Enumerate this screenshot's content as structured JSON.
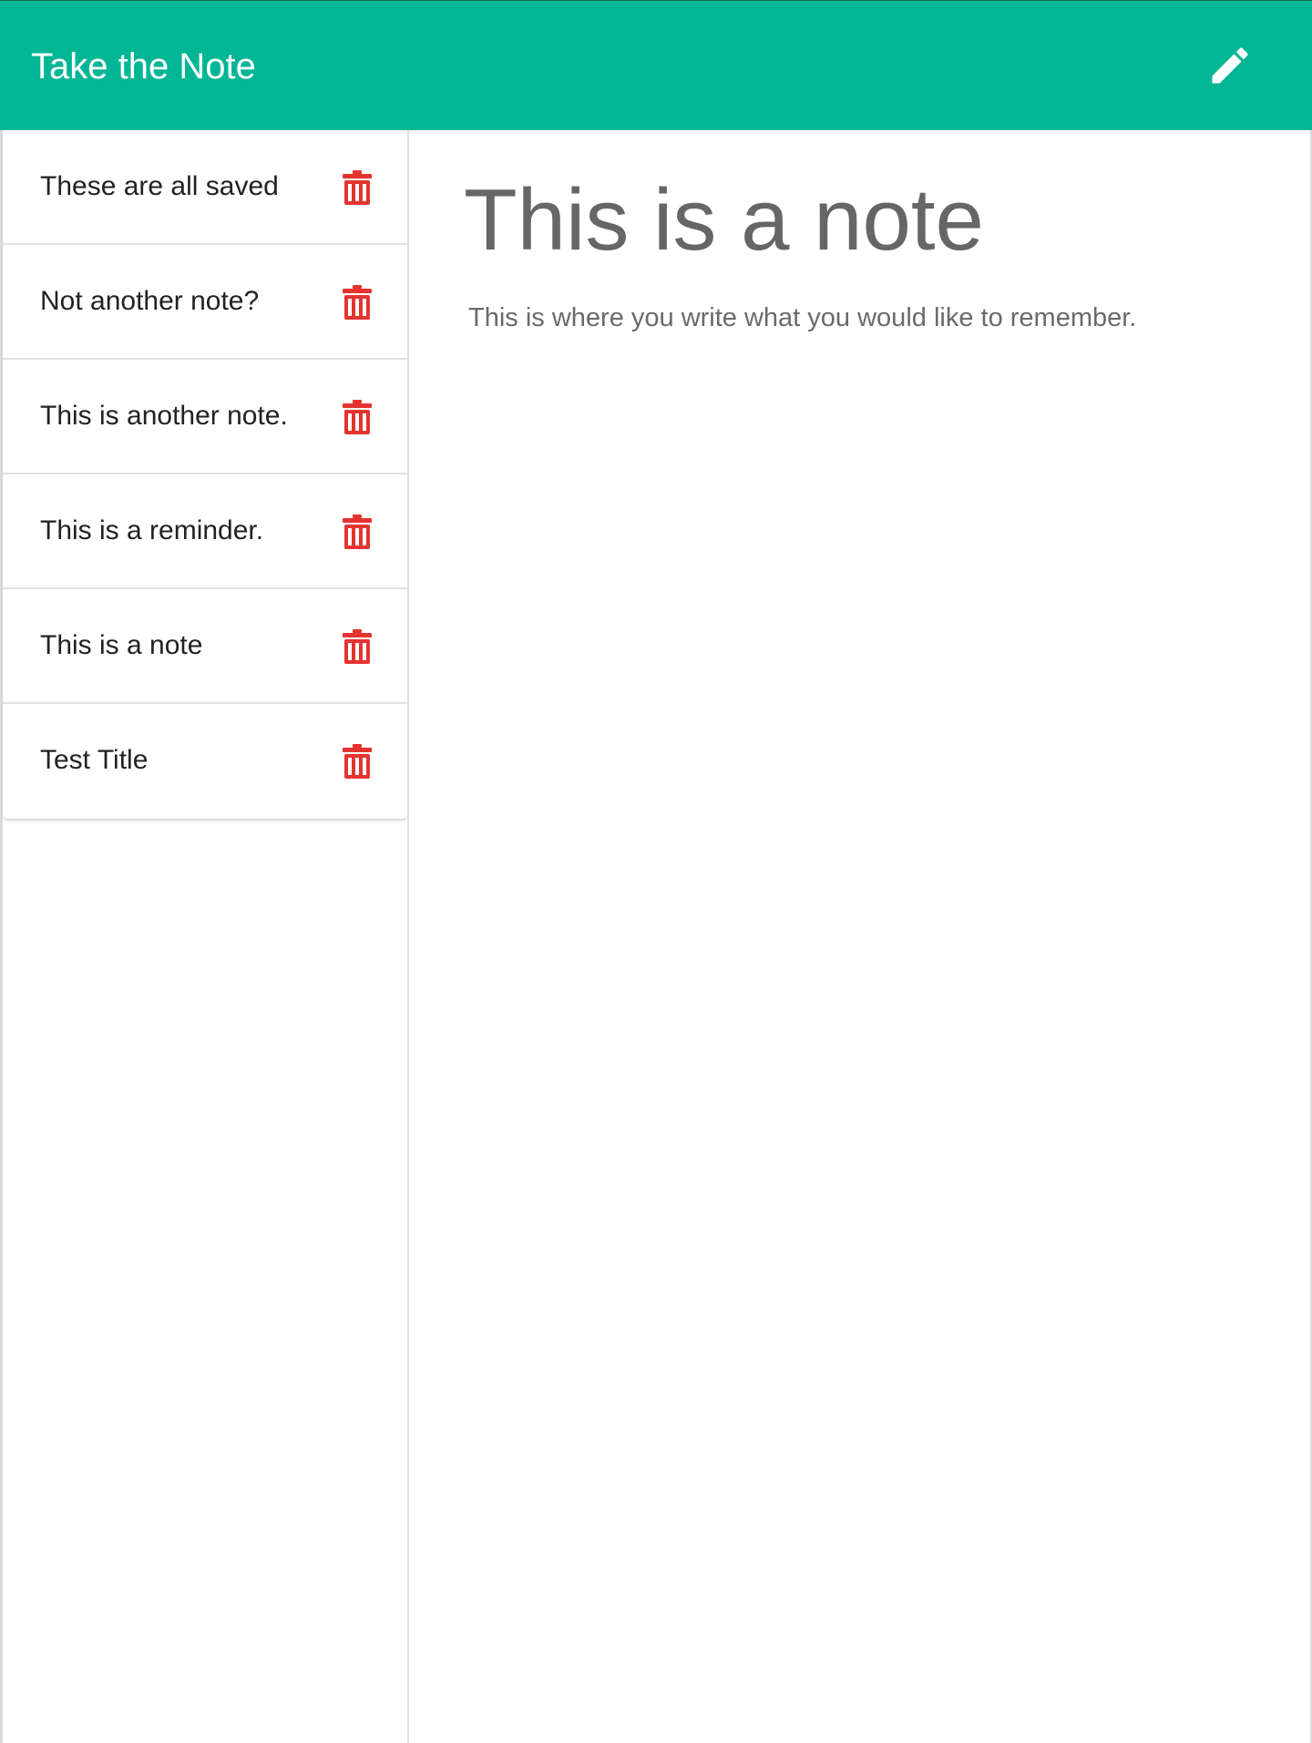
{
  "navbar": {
    "app_title": "Take the Note",
    "new_note_icon": "pencil-icon",
    "accent_color": "#00b695"
  },
  "sidebar": {
    "delete_icon": "trash-icon",
    "delete_color": "#e5342f",
    "notes": [
      {
        "title": "These are all saved"
      },
      {
        "title": "Not another note?"
      },
      {
        "title": "This is another note."
      },
      {
        "title": "This is a reminder."
      },
      {
        "title": "This is a note"
      },
      {
        "title": "Test Title"
      }
    ]
  },
  "editor": {
    "title_value": "This is a note",
    "body_value": "This is where you write what you would like to remember."
  }
}
